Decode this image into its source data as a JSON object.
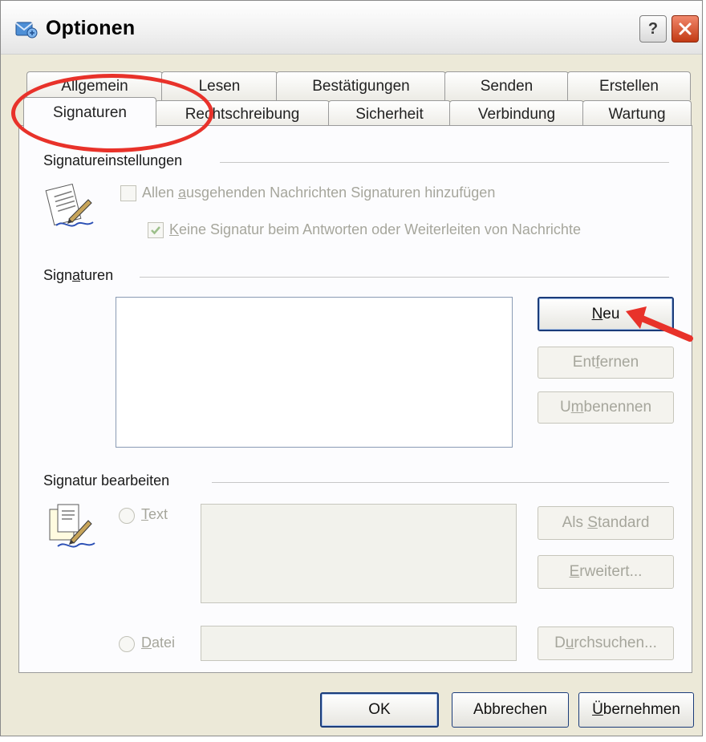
{
  "window": {
    "title": "Optionen",
    "help_glyph": "?"
  },
  "tabs_row1": [
    "Allgemein",
    "Lesen",
    "Bestätigungen",
    "Senden",
    "Erstellen"
  ],
  "tabs_row2": [
    "Signaturen",
    "Rechtschreibung",
    "Sicherheit",
    "Verbindung",
    "Wartung"
  ],
  "signature_settings": {
    "group_label": "Signatureinstellungen",
    "option_add_pre": "Allen ",
    "option_add_u": "a",
    "option_add_post": "usgehenden Nachrichten Signaturen hinzufügen",
    "option_add_checked": false,
    "option_reply_u": "K",
    "option_reply_post": "eine Signatur beim Antworten oder Weiterleiten von Nachrichte",
    "option_reply_checked": true
  },
  "signatures": {
    "group_label_pre": "Sign",
    "group_label_u": "a",
    "group_label_post": "turen",
    "new_u": "N",
    "new_post": "eu",
    "remove_pre": "Ent",
    "remove_u": "f",
    "remove_post": "ernen",
    "rename_pre": "U",
    "rename_u": "m",
    "rename_post": "benennen"
  },
  "edit_signature": {
    "group_label": "Signatur bearbeiten",
    "text_u": "T",
    "text_post": "ext",
    "file_u": "D",
    "file_post": "atei",
    "default_pre": "Als ",
    "default_u": "S",
    "default_post": "tandard",
    "advanced_u": "E",
    "advanced_post": "rweitert...",
    "browse_pre": "D",
    "browse_u": "u",
    "browse_post": "rchsuchen..."
  },
  "footer": {
    "ok_label": "OK",
    "cancel_label": "Abbrechen",
    "apply_u": "Ü",
    "apply_post": "bernehmen"
  },
  "colors": {
    "annotation": "#e8322a",
    "button_border": "#1b3c7a",
    "disabled_text": "#a6a69c"
  }
}
